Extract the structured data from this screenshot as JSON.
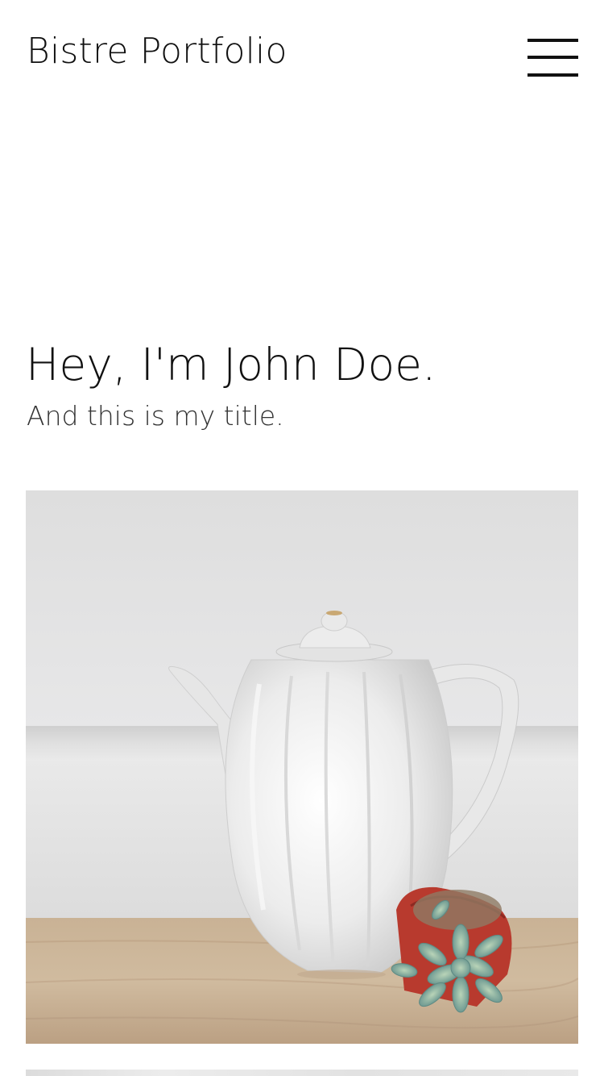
{
  "header": {
    "site_title": "Bistre Portfolio",
    "menu_icon": "hamburger-menu-icon"
  },
  "hero": {
    "heading": "Hey, I'm John Doe.",
    "subheading": "And this is my title."
  },
  "gallery": {
    "items": [
      {
        "description_icon": "teapot-photo"
      },
      {
        "description_icon": "next-photo"
      }
    ]
  },
  "colors": {
    "text": "#111111",
    "background": "#ffffff"
  }
}
